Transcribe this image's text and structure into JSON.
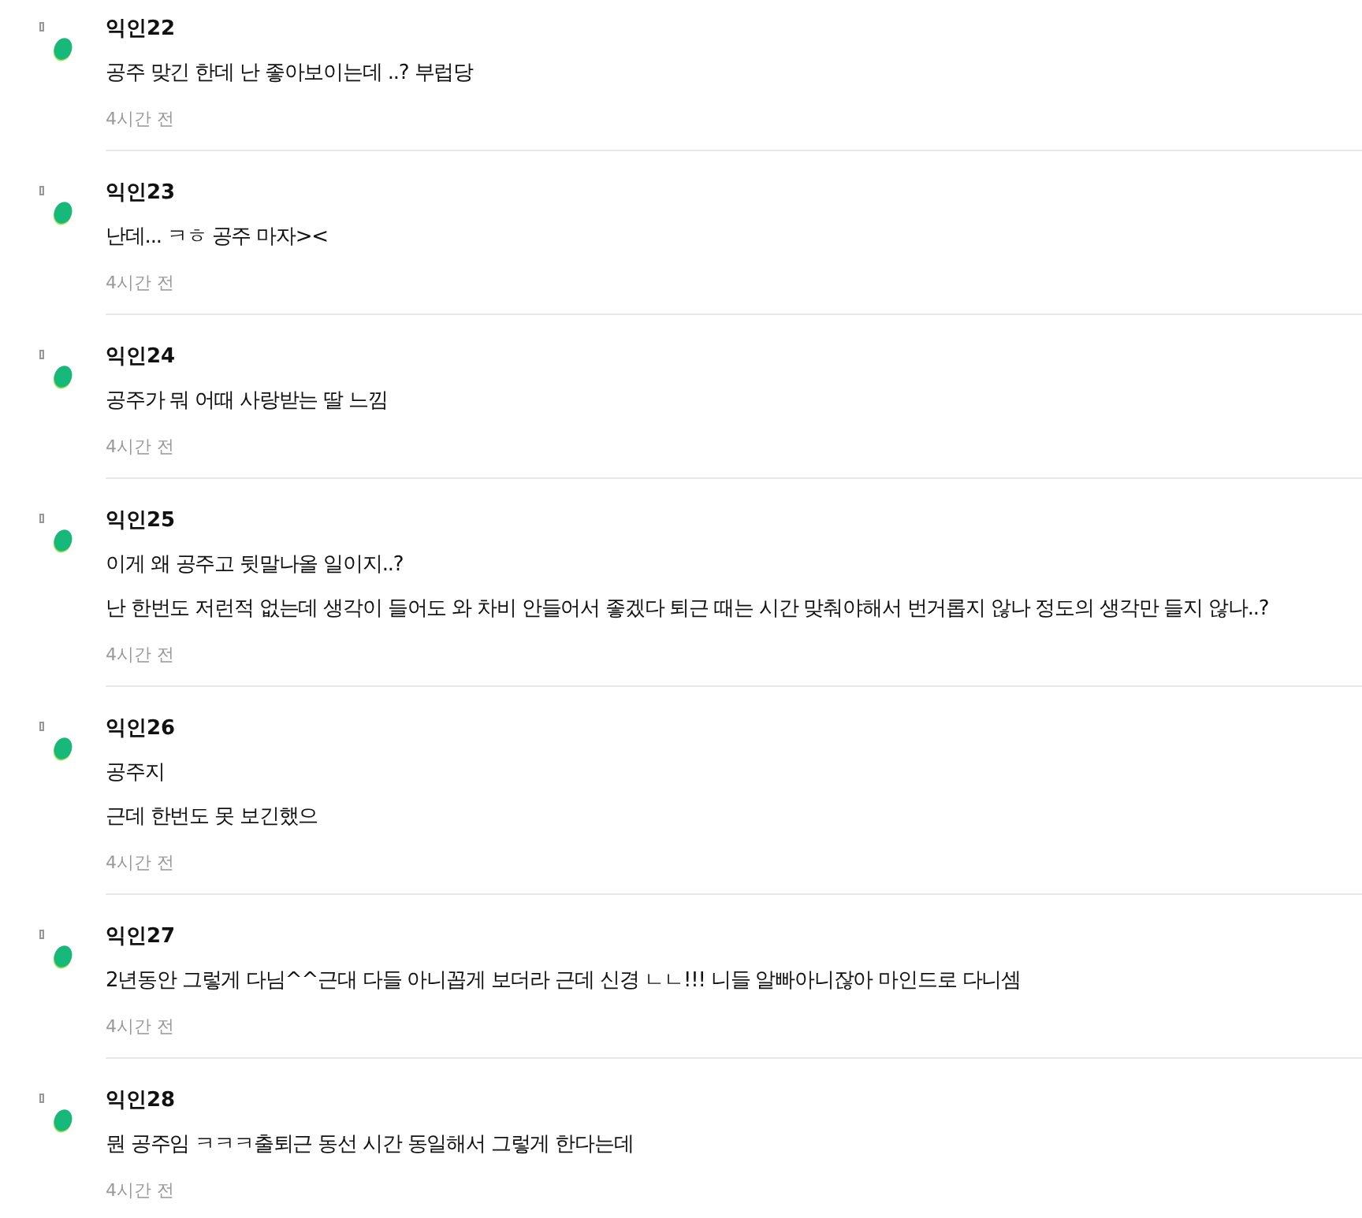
{
  "comments": [
    {
      "author": "익인22",
      "lines": [
        "공주 맞긴 한데 난 좋아보이는데 ..? 부럽당"
      ],
      "time": "4시간 전"
    },
    {
      "author": "익인23",
      "lines": [
        "난데... ㅋㅎ 공주 마자><"
      ],
      "time": "4시간 전"
    },
    {
      "author": "익인24",
      "lines": [
        "공주가 뭐 어때 사랑받는 딸 느낌"
      ],
      "time": "4시간 전"
    },
    {
      "author": "익인25",
      "lines": [
        "이게 왜 공주고 뒷말나올 일이지..?",
        "난 한번도 저런적 없는데 생각이 들어도 와 차비 안들어서 좋겠다 퇴근 때는 시간 맞춰야해서 번거롭지 않나 정도의 생각만 들지 않나..?"
      ],
      "time": "4시간 전"
    },
    {
      "author": "익인26",
      "lines": [
        "공주지",
        "근데 한번도 못 보긴했으"
      ],
      "time": "4시간 전"
    },
    {
      "author": "익인27",
      "lines": [
        "2년동안 그렇게 다님^^근대 다들 아니꼽게 보더라 근데 신경 ㄴㄴ!!! 니들 알빠아니잖아 마인드로 다니셈"
      ],
      "time": "4시간 전"
    },
    {
      "author": "익인28",
      "lines": [
        "뭔 공주임 ㅋㅋㅋ출퇴근 동선 시간 동일해서 그렇게 한다는데"
      ],
      "time": "4시간 전"
    }
  ]
}
